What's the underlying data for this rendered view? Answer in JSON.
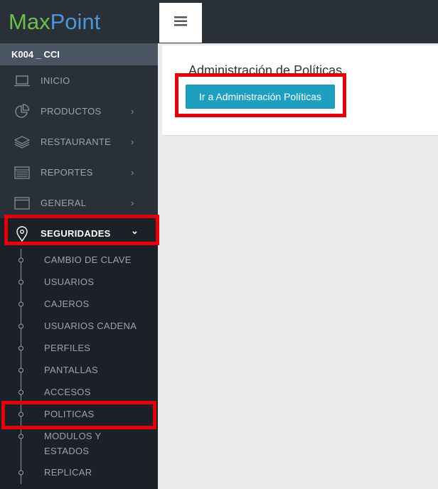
{
  "app": {
    "logo_part1": "Max",
    "logo_part2": "Point",
    "user": "K004 _ CCI"
  },
  "menu": [
    {
      "label": "INICIO",
      "icon": "laptop-icon",
      "chevron": ""
    },
    {
      "label": "PRODUCTOS",
      "icon": "pie-chart-icon",
      "chevron": "›"
    },
    {
      "label": "RESTAURANTE",
      "icon": "layers-icon",
      "chevron": "›"
    },
    {
      "label": "REPORTES",
      "icon": "list-icon",
      "chevron": "›"
    },
    {
      "label": "GENERAL",
      "icon": "window-icon",
      "chevron": "›"
    },
    {
      "label": "SEGURIDADES",
      "icon": "map-pin-icon",
      "chevron": "⌄"
    }
  ],
  "submenu": [
    {
      "label": "CAMBIO DE CLAVE"
    },
    {
      "label": "USUARIOS"
    },
    {
      "label": "CAJEROS"
    },
    {
      "label": "USUARIOS CADENA"
    },
    {
      "label": "PERFILES"
    },
    {
      "label": "PANTALLAS"
    },
    {
      "label": "ACCESOS"
    },
    {
      "label": "POLITICAS"
    },
    {
      "label": "MODULOS Y ESTADOS"
    },
    {
      "label": "REPLICAR"
    }
  ],
  "topbar": {
    "menu_icon": "hamburger-icon"
  },
  "main": {
    "title": "Administración de Políticas",
    "button_label": "Ir a Administración Políticas"
  },
  "colors": {
    "accent": "#1e9fc2",
    "sidebar": "#2a3038",
    "highlight": "#e3000b"
  }
}
